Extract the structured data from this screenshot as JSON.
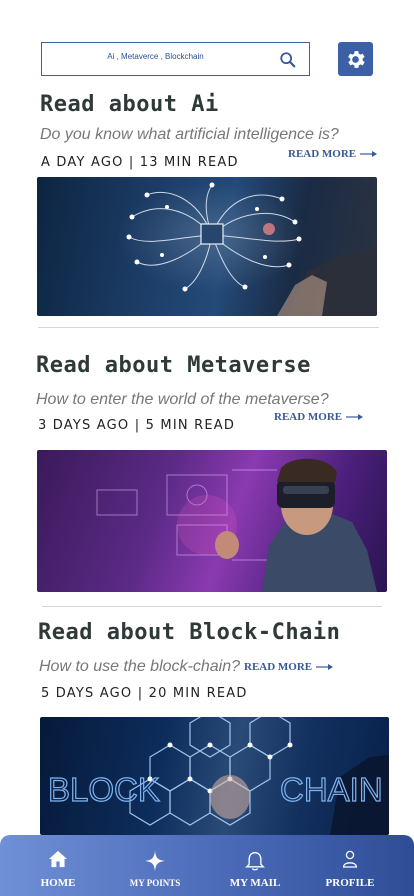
{
  "search": {
    "value": "Ai , Metaverce , Blockchain"
  },
  "articles": [
    {
      "title": "Read about Ai",
      "subtitle": "Do you know what artificial intelligence is?",
      "meta": "A DAY AGO | 13 MIN READ",
      "read_more": "READ MORE"
    },
    {
      "title": "Read about Metaverse",
      "subtitle": "How to enter the world of the metaverse?",
      "meta": "3 DAYS AGO | 5 MIN READ",
      "read_more": "READ MORE"
    },
    {
      "title": "Read about Block-Chain",
      "subtitle": "How to use the block-chain?",
      "meta": "5 DAYS AGO | 20 MIN READ",
      "read_more": "READ MORE",
      "image_text_left": "BLOCK",
      "image_text_right": "CHAIN"
    }
  ],
  "nav": {
    "items": [
      {
        "label": "HOME",
        "icon": "home-icon"
      },
      {
        "label": "MY POINTS",
        "icon": "sparkle-icon"
      },
      {
        "label": "MY MAIL",
        "icon": "bell-icon"
      },
      {
        "label": "PROFILE",
        "icon": "user-icon"
      }
    ]
  },
  "colors": {
    "accent": "#3d5fa6",
    "nav_gradient_start": "#6f8fd6",
    "nav_gradient_end": "#2f4d96",
    "title": "#2f3a38"
  }
}
